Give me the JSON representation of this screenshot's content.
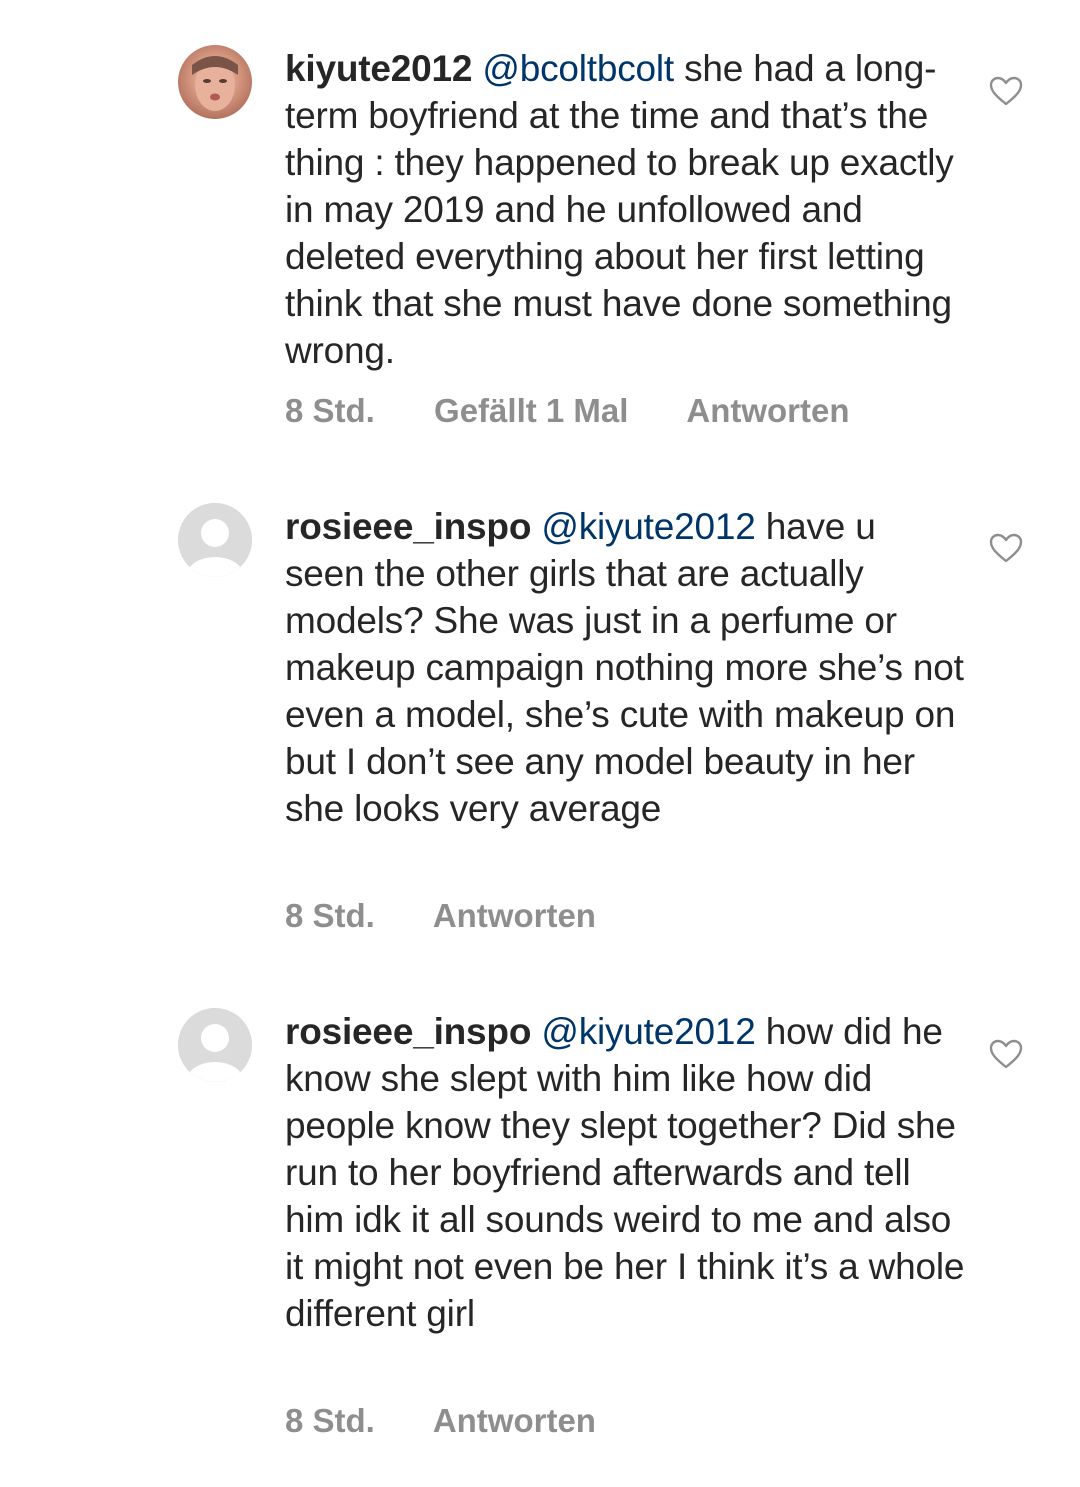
{
  "comments": [
    {
      "username": "kiyute2012",
      "mention": "@bcoltbcolt",
      "text": "she had a long-term boyfriend at the time and that’s the thing : they happened to break up exactly in may 2019 and he unfollowed and deleted everything about her first letting think that she must have done something wrong.",
      "time": "8 Std.",
      "likes": "Gefällt 1 Mal",
      "reply": "Antworten",
      "avatar": "profile-photo"
    },
    {
      "username": "rosieee_inspo",
      "mention": "@kiyute2012",
      "text": "have u seen the other girls that are actually models? She was just in a perfume or makeup campaign nothing more she’s not even a model, she’s cute with makeup on but I don’t see any model beauty in her she looks very average",
      "time": "8 Std.",
      "reply": "Antworten",
      "avatar": "default-avatar"
    },
    {
      "username": "rosieee_inspo",
      "mention": "@kiyute2012",
      "text": "how did he know she slept with him like how did people know they slept together? Did she run to her boyfriend afterwards and tell him idk it all sounds weird to me and also it might not even be her I think it’s a whole different girl",
      "time": "8 Std.",
      "reply": "Antworten",
      "avatar": "default-avatar"
    }
  ],
  "icons": {
    "like": "heart-outline-icon"
  },
  "colors": {
    "text": "#262626",
    "mention": "#003569",
    "meta": "#8e8e8e",
    "heart": "#8e8e8e"
  }
}
